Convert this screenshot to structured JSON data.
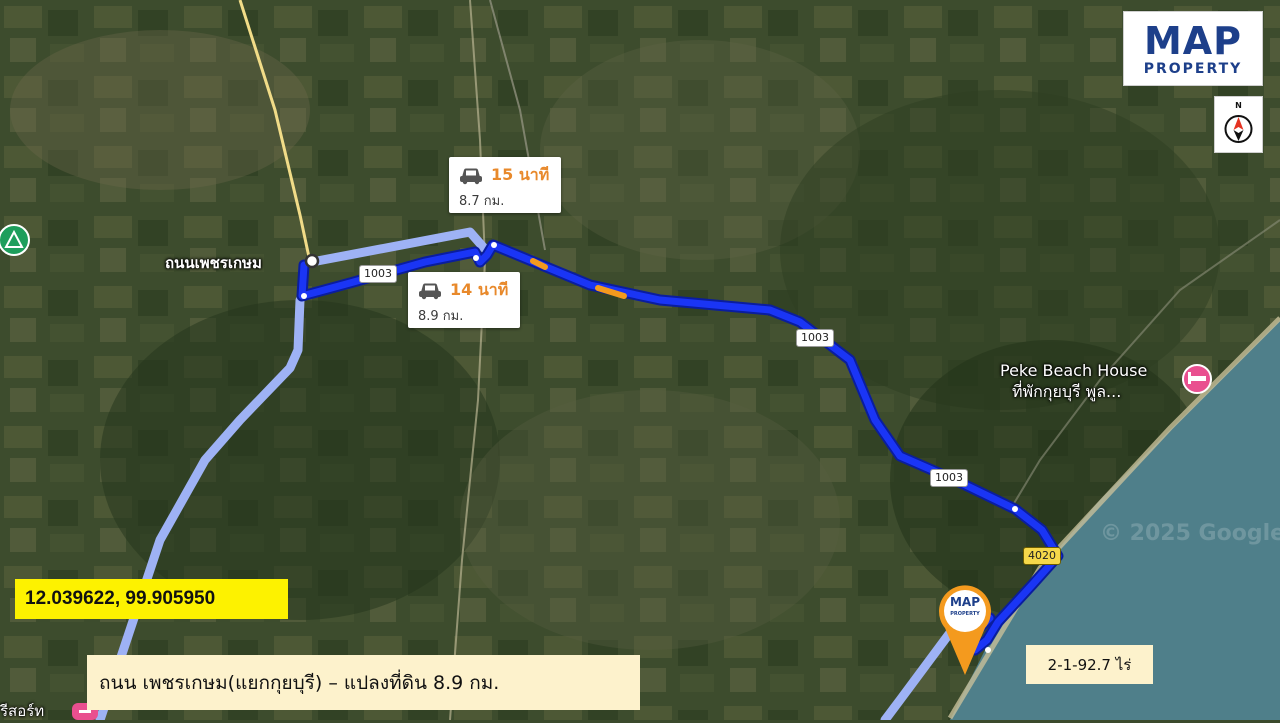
{
  "map": {
    "satellite_base": "#3b4a2c",
    "sea_color": "#4f7f8a",
    "route_color": "#1a35f5",
    "alt_route_color": "#9eb2f5",
    "traffic_color": "#f49a1e",
    "place_labels": {
      "origin": "ถนนเพชรเกษม",
      "beach_house_line1": "Peke Beach House",
      "beach_house_line2": "ที่พักกุยบุรี พูล...",
      "resort_partial": "รีสอร์ท"
    },
    "road_badges": [
      "1003",
      "1003",
      "1003",
      "4020"
    ],
    "watermark": "© 2025 Google",
    "marker_icon": "map-property-pin"
  },
  "routes": {
    "alt": {
      "time": "15 นาที",
      "distance": "8.7 กม."
    },
    "main": {
      "time": "14 นาที",
      "distance": "8.9 กม."
    }
  },
  "logo": {
    "main": "MAP",
    "sub": "PROPERTY",
    "pin_main": "MAP",
    "pin_sub": "PROPERTY"
  },
  "compass": {
    "north_label": "N"
  },
  "coordinates": "12.039622, 99.905950",
  "caption": "ถนน เพชรเกษม(แยกกุยบุรี) – แปลงที่ดิน  8.9 กม.",
  "area": "2-1-92.7 ไร่"
}
